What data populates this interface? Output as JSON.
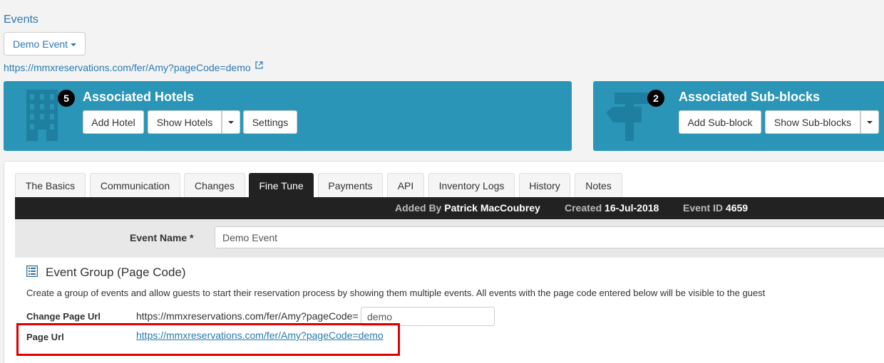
{
  "breadcrumb": "Events",
  "event_selector": {
    "label": "Demo Event"
  },
  "event_url": "https://mmxreservations.com/fer/Amy?pageCode=demo",
  "hotels_panel": {
    "count": "5",
    "title": "Associated Hotels",
    "buttons": {
      "add": "Add Hotel",
      "show": "Show Hotels",
      "settings": "Settings"
    }
  },
  "subblocks_panel": {
    "count": "2",
    "title": "Associated Sub-blocks",
    "buttons": {
      "add": "Add Sub-block",
      "show": "Show Sub-blocks"
    }
  },
  "tabs": [
    {
      "label": "The Basics"
    },
    {
      "label": "Communication"
    },
    {
      "label": "Changes"
    },
    {
      "label": "Fine Tune",
      "active": true
    },
    {
      "label": "Payments"
    },
    {
      "label": "API"
    },
    {
      "label": "Inventory Logs"
    },
    {
      "label": "History"
    },
    {
      "label": "Notes"
    }
  ],
  "info_bar": {
    "added_by_label": "Added By",
    "added_by_value": "Patrick MacCoubrey",
    "created_label": "Created",
    "created_value": "16-Jul-2018",
    "event_id_label": "Event ID",
    "event_id_value": "4659"
  },
  "form": {
    "event_name_label": "Event Name *",
    "event_name_value": "Demo Event"
  },
  "section": {
    "title": "Event Group (Page Code)",
    "description": "Create a group of events and allow guests to start their reservation process by showing them multiple events. All events with the page code entered below will be visible to the guest",
    "change_page_url_label": "Change Page Url",
    "url_prefix": "https://mmxreservations.com/fer/Amy?pageCode=",
    "page_code_value": "demo",
    "page_url_label": "Page Url",
    "page_url_link": "https://mmxreservations.com/fer/Amy?pageCode=demo"
  },
  "colors": {
    "panel": "#2b95b7",
    "link": "#2a7ab0",
    "highlight": "#e00000",
    "dark_bar": "#222222"
  }
}
